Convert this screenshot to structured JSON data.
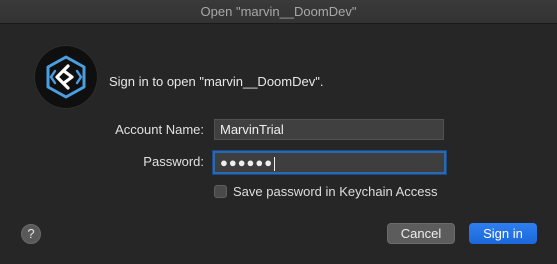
{
  "window": {
    "title": "Open \"marvin__DoomDev\""
  },
  "app_icon": {
    "name": "filemaker-app-icon",
    "background": "#0f0f10",
    "accent": "#4a9fe0"
  },
  "message": "Sign in to open \"marvin__DoomDev\".",
  "form": {
    "account_label": "Account Name:",
    "account_value": "MarvinTrial",
    "password_label": "Password:",
    "password_value": "●●●●●●",
    "save_password_label": "Save password in Keychain Access",
    "save_password_checked": false
  },
  "buttons": {
    "help": "?",
    "cancel": "Cancel",
    "signin": "Sign in"
  },
  "colors": {
    "background": "#262626",
    "focus_ring": "#2a69b1",
    "primary_button": "#1b68d9"
  }
}
